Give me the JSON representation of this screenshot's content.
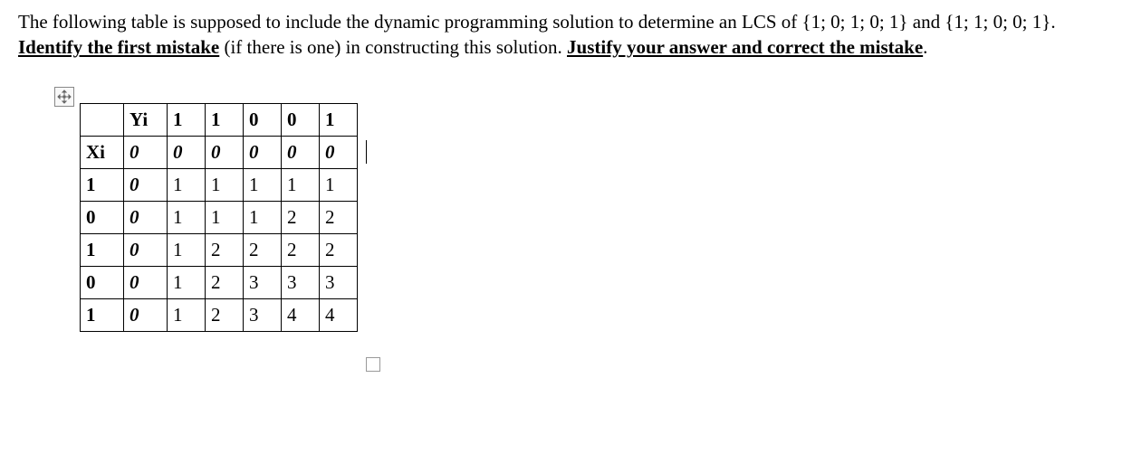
{
  "problem": {
    "part1": "The following table is supposed to include the dynamic programming solution to determine an LCS of {1; 0; 1; 0; 1} and {1; 1; 0; 0; 1}. ",
    "emph1": "Identify the first mistake",
    "part2": " (if there is one) in constructing this solution. ",
    "emph2": "Justify your answer and correct the mistake",
    "part3": "."
  },
  "table": {
    "yi_label": "Yi",
    "xi_label": "Xi",
    "y_header": [
      "1",
      "1",
      "0",
      "0",
      "1"
    ],
    "x_labels": [
      "1",
      "0",
      "1",
      "0",
      "1"
    ],
    "zero": "0",
    "rows": [
      [
        "0",
        "0",
        "0",
        "0",
        "0",
        "0"
      ],
      [
        "0",
        "1",
        "1",
        "1",
        "1",
        "1"
      ],
      [
        "0",
        "1",
        "1",
        "1",
        "2",
        "2"
      ],
      [
        "0",
        "1",
        "2",
        "2",
        "2",
        "2"
      ],
      [
        "0",
        "1",
        "2",
        "3",
        "3",
        "3"
      ],
      [
        "0",
        "1",
        "2",
        "3",
        "4",
        "4"
      ]
    ]
  },
  "icons": {
    "move": "move-handle-icon",
    "endmark": "document-end-marker"
  }
}
